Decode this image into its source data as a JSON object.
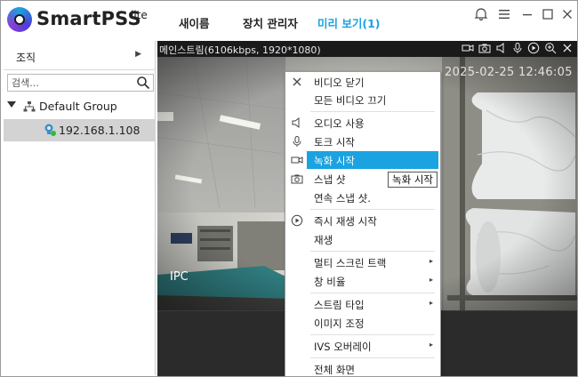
{
  "app": {
    "name": "SmartPSS",
    "edition": "lite"
  },
  "nav": {
    "tabs": [
      {
        "label": "새이름",
        "active": false
      },
      {
        "label": "장치 관리자",
        "active": false
      },
      {
        "label": "미리 보기(1)",
        "active": true
      }
    ]
  },
  "sidebar": {
    "org_label": "조직",
    "search_placeholder": "검색...",
    "group_label": "Default Group",
    "device_label": "192.168.1.108"
  },
  "video": {
    "stream_info": "메인스트림(6106kbps, 1920*1080)",
    "timestamp": "2025-02-25 12:46:05",
    "channel_label": "IPC",
    "header_icons": [
      "record-icon",
      "snapshot-icon",
      "audio-icon",
      "mic-icon",
      "play-icon",
      "zoom-icon",
      "close-icon"
    ]
  },
  "context_menu": {
    "items": [
      {
        "label": "비디오 닫기",
        "icon": "close-icon",
        "submenu": false,
        "highlighted": false
      },
      {
        "label": "모든 비디오 끄기",
        "icon": "",
        "submenu": false,
        "highlighted": false
      },
      {
        "label": "오디오 사용",
        "icon": "speaker-icon",
        "submenu": false,
        "highlighted": false
      },
      {
        "label": "토크 시작",
        "icon": "microphone-icon",
        "submenu": false,
        "highlighted": false
      },
      {
        "label": "녹화 시작",
        "icon": "record-icon",
        "submenu": false,
        "highlighted": true
      },
      {
        "label": "스냅 샷",
        "icon": "camera-icon",
        "submenu": false,
        "highlighted": false
      },
      {
        "label": "연속 스냅 샷.",
        "icon": "",
        "submenu": false,
        "highlighted": false
      },
      {
        "label": "즉시 재생 시작",
        "icon": "play-icon",
        "submenu": false,
        "highlighted": false
      },
      {
        "label": "재생",
        "icon": "",
        "submenu": false,
        "highlighted": false
      },
      {
        "label": "멀티 스크린 트랙",
        "icon": "",
        "submenu": true,
        "highlighted": false
      },
      {
        "label": "창 비율",
        "icon": "",
        "submenu": true,
        "highlighted": false
      },
      {
        "label": "스트림 타입",
        "icon": "",
        "submenu": true,
        "highlighted": false
      },
      {
        "label": "이미지 조정",
        "icon": "",
        "submenu": false,
        "highlighted": false
      },
      {
        "label": "IVS 오버레이",
        "icon": "",
        "submenu": true,
        "highlighted": false
      },
      {
        "label": "전체 화면",
        "icon": "",
        "submenu": false,
        "highlighted": false
      }
    ]
  },
  "tooltip": {
    "text": "녹화 시작"
  },
  "colors": {
    "accent": "#1aa3e0",
    "selected_row": "#d3d3d3"
  }
}
